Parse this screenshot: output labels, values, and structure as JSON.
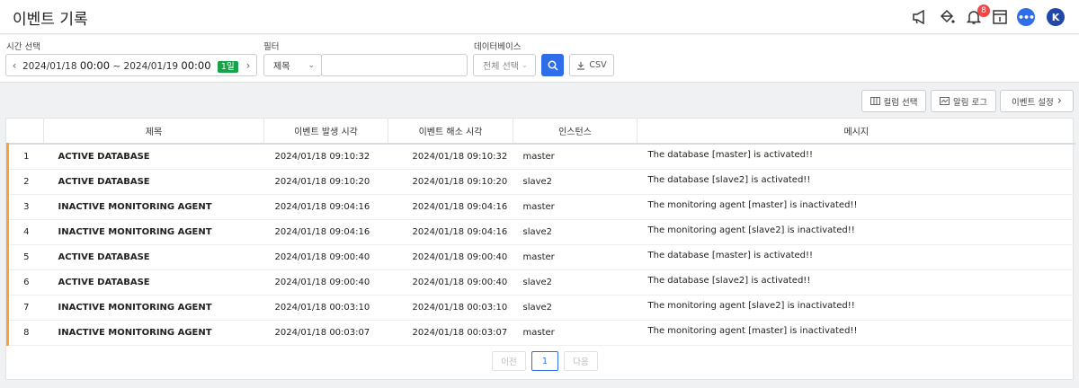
{
  "header": {
    "title": "이벤트 기록",
    "notification_count": "8",
    "avatar_initial": "K",
    "icons": [
      "megaphone-icon",
      "paint-bucket-icon",
      "bell-icon",
      "info-panel-icon",
      "chat-icon"
    ]
  },
  "filters": {
    "time_label": "시간 선택",
    "time_start_date": "2024/01/18",
    "time_start_clock": "00:00",
    "time_sep": "~",
    "time_end_date": "2024/01/19",
    "time_end_clock": "00:00",
    "time_range": "1일",
    "filter_label": "필터",
    "filter_field": "제목",
    "filter_value": "",
    "db_label": "데이터베이스",
    "db_select": "전체 선택",
    "csv_label": "CSV"
  },
  "toolbar": {
    "column_select": "컬럼 선택",
    "alert_log": "알림 로그",
    "event_settings": "이벤트 설정"
  },
  "table": {
    "columns": [
      "",
      "제목",
      "이벤트 발생 시각",
      "이벤트 해소 시각",
      "인스턴스",
      "메시지"
    ],
    "rows": [
      {
        "num": "1",
        "title": "ACTIVE DATABASE",
        "occurred": "2024/01/18 09:10:32",
        "resolved": "2024/01/18 09:10:32",
        "instance": "master",
        "message": "The database [master] is activated!!"
      },
      {
        "num": "2",
        "title": "ACTIVE DATABASE",
        "occurred": "2024/01/18 09:10:20",
        "resolved": "2024/01/18 09:10:20",
        "instance": "slave2",
        "message": "The database [slave2] is activated!!"
      },
      {
        "num": "3",
        "title": "INACTIVE MONITORING AGENT",
        "occurred": "2024/01/18 09:04:16",
        "resolved": "2024/01/18 09:04:16",
        "instance": "master",
        "message": "The monitoring agent [master] is inactivated!!"
      },
      {
        "num": "4",
        "title": "INACTIVE MONITORING AGENT",
        "occurred": "2024/01/18 09:04:16",
        "resolved": "2024/01/18 09:04:16",
        "instance": "slave2",
        "message": "The monitoring agent [slave2] is inactivated!!"
      },
      {
        "num": "5",
        "title": "ACTIVE DATABASE",
        "occurred": "2024/01/18 09:00:40",
        "resolved": "2024/01/18 09:00:40",
        "instance": "master",
        "message": "The database [master] is activated!!"
      },
      {
        "num": "6",
        "title": "ACTIVE DATABASE",
        "occurred": "2024/01/18 09:00:40",
        "resolved": "2024/01/18 09:00:40",
        "instance": "slave2",
        "message": "The database [slave2] is activated!!"
      },
      {
        "num": "7",
        "title": "INACTIVE MONITORING AGENT",
        "occurred": "2024/01/18 00:03:10",
        "resolved": "2024/01/18 00:03:10",
        "instance": "slave2",
        "message": "The monitoring agent [slave2] is inactivated!!"
      },
      {
        "num": "8",
        "title": "INACTIVE MONITORING AGENT",
        "occurred": "2024/01/18 00:03:07",
        "resolved": "2024/01/18 00:03:07",
        "instance": "master",
        "message": "The monitoring agent [master] is inactivated!!"
      }
    ]
  },
  "pagination": {
    "prev": "이전",
    "current": "1",
    "next": "다음"
  },
  "colors": {
    "accent": "#2f6ee8",
    "row_marker": "#f7a23a",
    "range_chip": "#18a34a",
    "badge": "#f04848"
  }
}
